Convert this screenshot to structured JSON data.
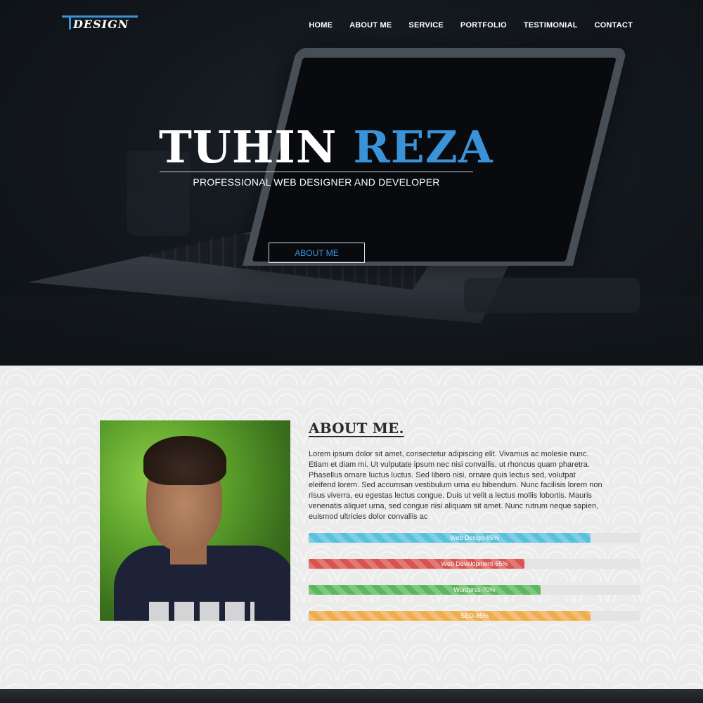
{
  "brand": {
    "logo_text": "DESIGN",
    "accent": "#3a93d8"
  },
  "nav": {
    "items": [
      {
        "label": "HOME"
      },
      {
        "label": "ABOUT ME"
      },
      {
        "label": "SERVICE"
      },
      {
        "label": "PORTFOLIO"
      },
      {
        "label": "TESTIMONIAL"
      },
      {
        "label": "CONTACT"
      }
    ]
  },
  "hero": {
    "first_name": "TUHIN",
    "last_name": "REZA",
    "subtitle": "PROFESSIONAL WEB DESIGNER AND DEVELOPER",
    "button_label": "ABOUT ME"
  },
  "about": {
    "title": "ABOUT ME.",
    "paragraph": "Lorem ipsum dolor sit amet, consectetur adipiscing elit. Vivamus ac molesie nunc. Etiam et diam mi. Ut vulputate ipsum nec nisi convallis, ut rhoncus quam pharetra. Phasellus ornare luctus luctus. Sed libero nisi, ornare quis lectus sed, volutpat eleifend lorem. Sed accumsan vestibulum urna eu bibendum. Nunc facilisis lorem non risus viverra, eu egestas lectus congue. Duis ut velit a lectus mollis lobortis. Mauris venenatis aliquet urna, sed congue nisi aliquam sit amet. Nunc rutrum neque sapien, euismod ultricies dolor convallis ac",
    "skills": [
      {
        "label": "Web Design-85%",
        "percent": 85,
        "color": "#5bc0de"
      },
      {
        "label": "Web Development-65%",
        "percent": 65,
        "color": "#d9534f"
      },
      {
        "label": "Wordprss-70%",
        "percent": 70,
        "color": "#5cb85c"
      },
      {
        "label": "SEO-85%",
        "percent": 85,
        "color": "#f0ad4e"
      }
    ]
  }
}
